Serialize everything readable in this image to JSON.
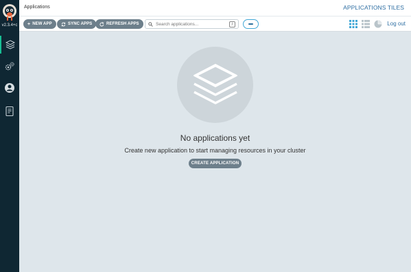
{
  "sidebar": {
    "version": "v2.3.4+c",
    "items": [
      {
        "name": "applications",
        "icon": "layers-icon"
      },
      {
        "name": "settings",
        "icon": "gears-icon"
      },
      {
        "name": "user-info",
        "icon": "user-circle-icon"
      },
      {
        "name": "documentation",
        "icon": "docs-icon"
      }
    ]
  },
  "header": {
    "title": "Applications",
    "view_title": "APPLICATIONS TILES"
  },
  "toolbar": {
    "new_app_label": "NEW APP",
    "sync_apps_label": "SYNC APPS",
    "refresh_apps_label": "REFRESH APPS",
    "search_placeholder": "Search applications...",
    "search_value": "",
    "search_shortcut": "/",
    "logout_label": "Log out"
  },
  "empty_state": {
    "title": "No applications yet",
    "subtitle": "Create new application to start managing resources in your cluster",
    "create_label": "CREATE APPLICATION"
  },
  "colors": {
    "sidebar_bg": "#0f2733",
    "main_bg": "#dee6eb",
    "button_bg": "#6d7f8b",
    "accent": "#18be94",
    "link": "#2f6fa3"
  }
}
